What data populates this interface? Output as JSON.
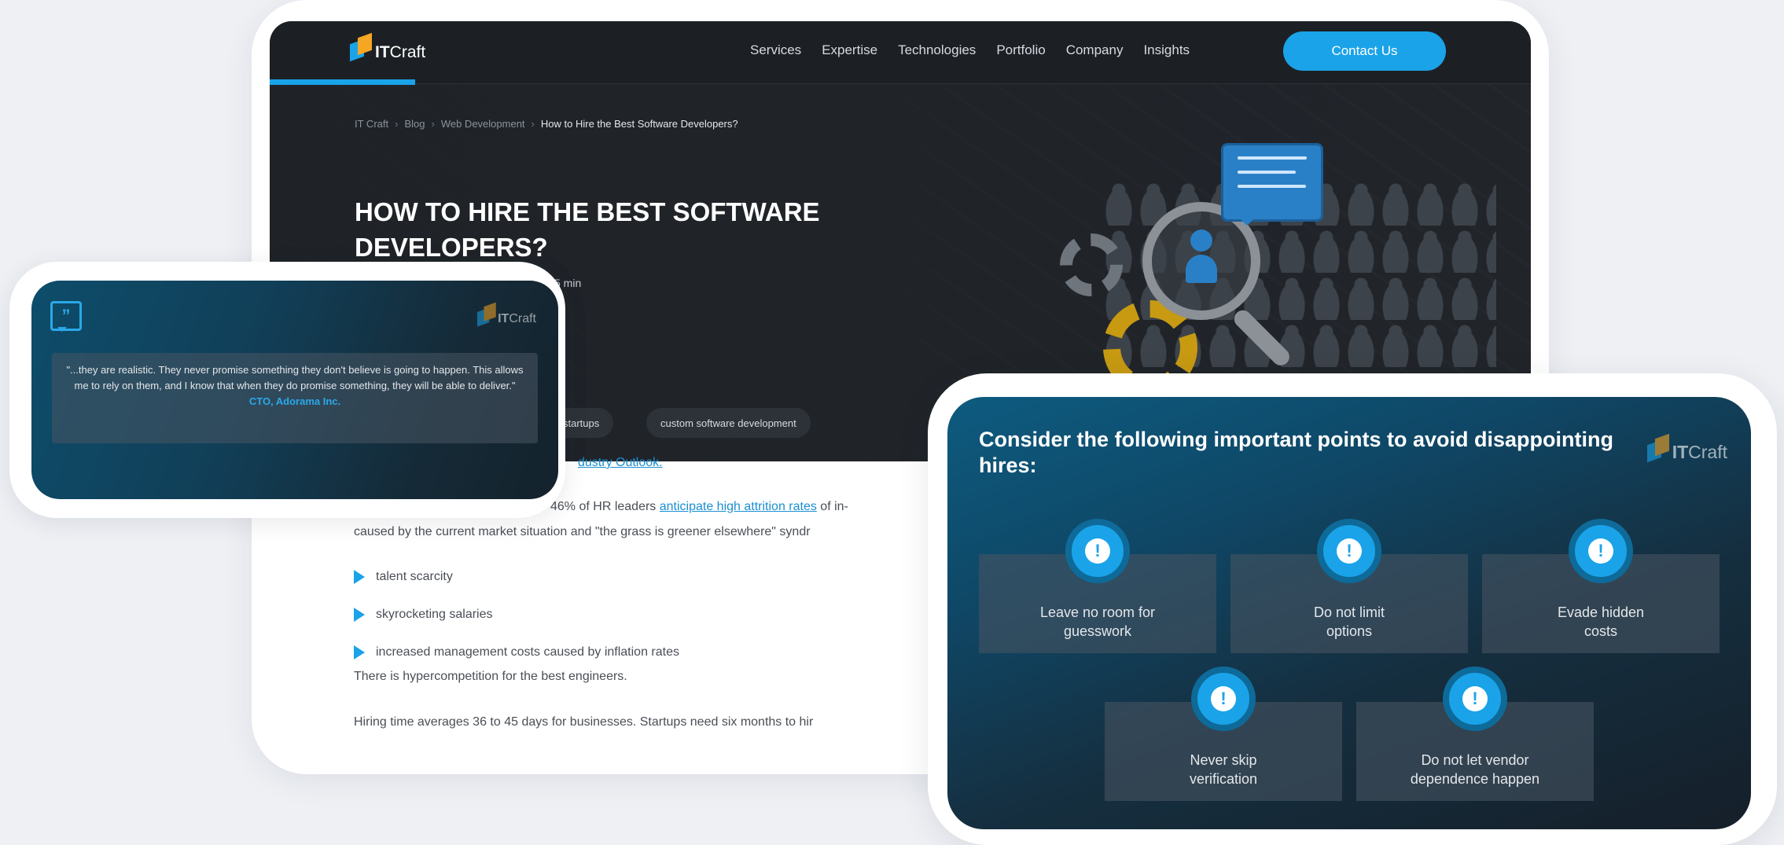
{
  "site": {
    "logo_prefix": "IT",
    "logo_suffix": "Craft",
    "nav": [
      "Services",
      "Expertise",
      "Technologies",
      "Portfolio",
      "Company",
      "Insights"
    ],
    "contact_label": "Contact Us",
    "breadcrumb": [
      "IT Craft",
      "Blog",
      "Web Development",
      "How to Hire the Best Software Developers?"
    ],
    "title": "HOW TO HIRE THE BEST SOFTWARE DEVELOPERS?",
    "read_time": "5 min",
    "tags": [
      "startups",
      "custom software development"
    ]
  },
  "article": {
    "source_link": "dustry Outlook.",
    "p1_prefix": "46% of HR leaders ",
    "p1_link": "anticipate high attrition rates",
    "p1_suffix": " of in-",
    "p2": "caused by the current market situation and \"the grass is greener elsewhere\" syndr",
    "bullets": [
      "talent scarcity",
      "skyrocketing salaries",
      "increased management costs caused by inflation rates"
    ],
    "p3": "There is hypercompetition for the best engineers.",
    "p4": "Hiring time averages 36 to 45 days for businesses. Startups need six months to hir"
  },
  "quote": {
    "icon": "quote-icon",
    "logo_prefix": "IT",
    "logo_suffix": "Craft",
    "text": "\"...they are realistic. They never promise something they don't believe is going to happen. This allows me to rely on them, and I know that when they do promise something, they will be able to deliver.\"",
    "author": "CTO, Adorama Inc."
  },
  "points": {
    "title": "Consider the following important points to avoid disappointing hires:",
    "logo_prefix": "IT",
    "logo_suffix": "Craft",
    "items": [
      {
        "line1": "Leave no room for",
        "line2": "guesswork"
      },
      {
        "line1": "Do not limit",
        "line2": "options"
      },
      {
        "line1": "Evade hidden",
        "line2": "costs"
      },
      {
        "line1": "Never skip",
        "line2": "verification"
      },
      {
        "line1": "Do not let vendor",
        "line2": "dependence happen"
      }
    ],
    "icon_glyph": "!"
  },
  "colors": {
    "accent": "#1aa3e8",
    "brand_orange": "#f5a623",
    "dark_bg": "#1f2328"
  }
}
